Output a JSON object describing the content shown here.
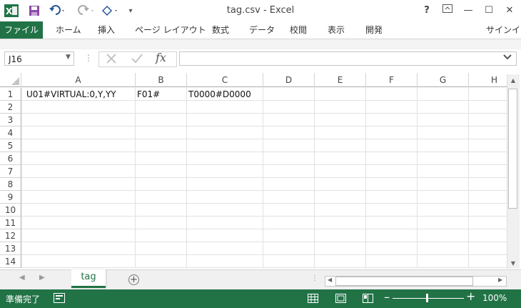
{
  "window": {
    "title": "tag.csv - Excel",
    "help_label": "?",
    "restore_ribbon_icon": "ribbon-display-icon",
    "minimize_label": "—",
    "maximize_label": "☐",
    "close_label": "✕"
  },
  "quick_access": {
    "excel_logo": "X",
    "save_icon": "save-icon",
    "undo_icon": "undo-icon",
    "redo_icon": "redo-icon",
    "touch_icon": "touch-mode-icon",
    "customize_label": "▾"
  },
  "ribbon": {
    "file_tab": "ファイル",
    "tabs": [
      "ホーム",
      "挿入",
      "ページ レイアウト",
      "数式",
      "データ",
      "校閲",
      "表示",
      "開発"
    ],
    "signin": "サインイン"
  },
  "formula_bar": {
    "name_box": "J16",
    "formula": ""
  },
  "columns": [
    "A",
    "B",
    "C",
    "D",
    "E",
    "F",
    "G",
    "H"
  ],
  "rows": [
    "1",
    "2",
    "3",
    "4",
    "5",
    "6",
    "7",
    "8",
    "9",
    "10",
    "11",
    "12",
    "13",
    "14"
  ],
  "cells": {
    "A1": "U01#VIRTUAL:0,Y,YY",
    "B1": "F01#",
    "C1": "T0000#D0000"
  },
  "sheet_tabs": [
    {
      "label": "tag",
      "active": true
    }
  ],
  "status": {
    "ready": "準備完了",
    "zoom": "100%"
  },
  "accent_color": "#217346"
}
